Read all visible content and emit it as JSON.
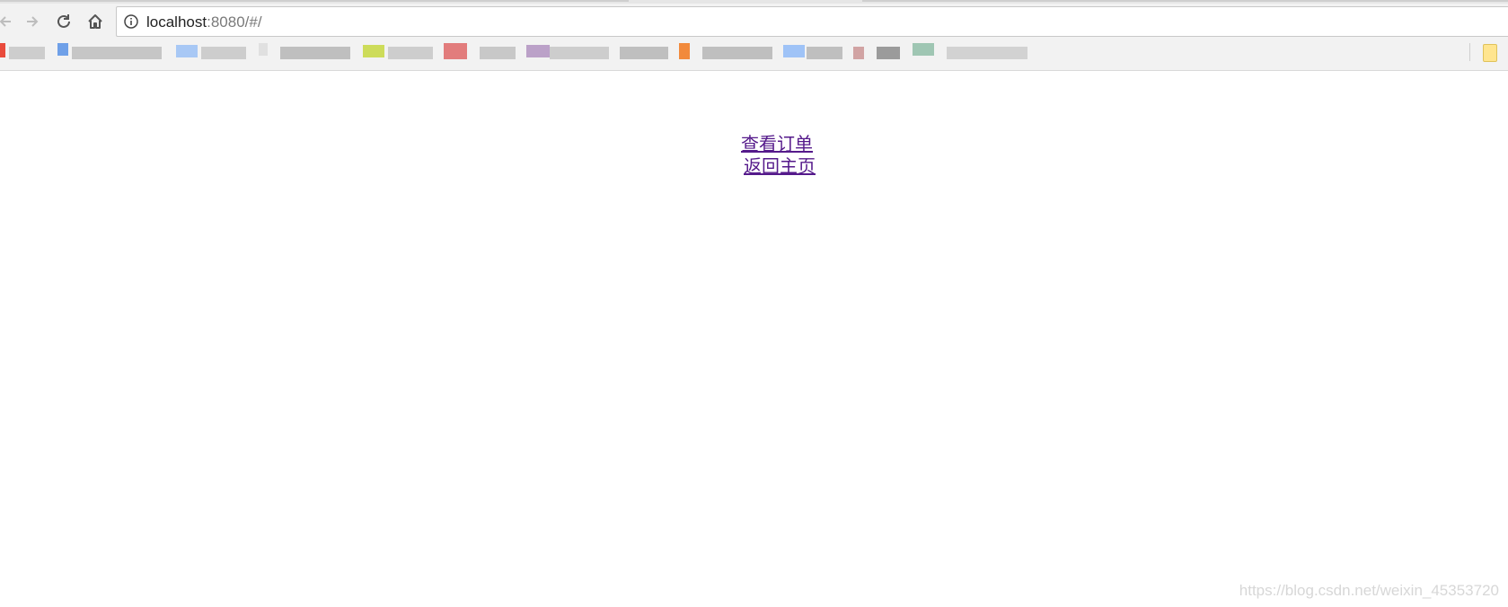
{
  "browser": {
    "address_bar": {
      "host": "localhost",
      "path": ":8080/#/"
    },
    "icons": {
      "back": "arrow-left-icon",
      "forward": "arrow-right-icon",
      "reload": "reload-icon",
      "home": "home-icon",
      "site_info": "info-icon"
    }
  },
  "main": {
    "links": [
      {
        "label": "查看订单 "
      },
      {
        "label": "返回主页"
      }
    ]
  },
  "watermark": "https://blog.csdn.net/weixin_45353720",
  "colors": {
    "link_visited": "#551a8b",
    "chrome_bg": "#f2f2f2",
    "page_bg": "#ffffff"
  }
}
